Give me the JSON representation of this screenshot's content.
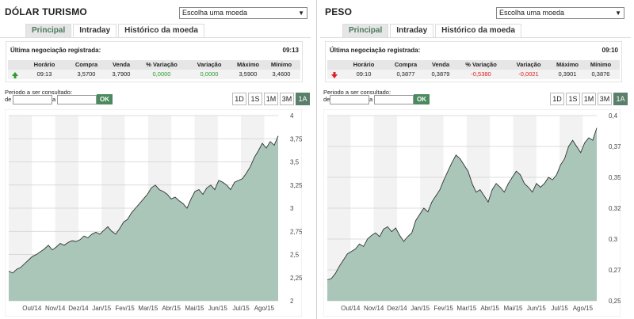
{
  "panels": [
    {
      "id": "dolar",
      "title": "DÓLAR TURISMO",
      "select_label": "Escolha uma moeda",
      "tabs": [
        "Principal",
        "Intraday",
        "Histórico da moeda"
      ],
      "active_tab": 0,
      "quote": {
        "header": "Última negociação registrada:",
        "time": "09:13",
        "direction": "up",
        "columns": [
          "Horário",
          "Compra",
          "Venda",
          "% Variação",
          "Variação",
          "Máximo",
          "Mínimo"
        ],
        "values": [
          "09:13",
          "3,5700",
          "3,7900",
          "0,0000",
          "0,0000",
          "3,5900",
          "3,4600"
        ],
        "value_colors": [
          "#222222",
          "#222222",
          "#222222",
          "#2e9e2e",
          "#2e9e2e",
          "#222222",
          "#222222"
        ]
      },
      "period": {
        "label": "Periodo a ser consultado:",
        "from_label": "de",
        "to_label": "a",
        "ok": "OK"
      },
      "ranges": [
        "1D",
        "1S",
        "1M",
        "3M",
        "1A"
      ],
      "active_range": 4,
      "chart_data": {
        "type": "area",
        "ylim": [
          2,
          4
        ],
        "yticks": [
          "2",
          "2,25",
          "2,5",
          "2,75",
          "3",
          "3,25",
          "3,5",
          "3,75",
          "4"
        ],
        "ytick_values": [
          2,
          2.25,
          2.5,
          2.75,
          3,
          3.25,
          3.5,
          3.75,
          4
        ],
        "xlabels": [
          "Out/14",
          "Nov/14",
          "Dez/14",
          "Jan/15",
          "Fev/15",
          "Mar/15",
          "Abr/15",
          "Mai/15",
          "Jun/15",
          "Jul/15",
          "Ago/15"
        ],
        "values": [
          2.32,
          2.3,
          2.34,
          2.36,
          2.4,
          2.44,
          2.48,
          2.5,
          2.53,
          2.56,
          2.6,
          2.55,
          2.58,
          2.62,
          2.6,
          2.63,
          2.65,
          2.64,
          2.66,
          2.7,
          2.68,
          2.72,
          2.74,
          2.72,
          2.76,
          2.8,
          2.75,
          2.72,
          2.78,
          2.85,
          2.88,
          2.95,
          3.0,
          3.05,
          3.1,
          3.15,
          3.22,
          3.25,
          3.2,
          3.18,
          3.15,
          3.1,
          3.12,
          3.08,
          3.05,
          3.0,
          3.1,
          3.18,
          3.2,
          3.15,
          3.22,
          3.25,
          3.2,
          3.3,
          3.28,
          3.25,
          3.2,
          3.28,
          3.3,
          3.32,
          3.38,
          3.45,
          3.55,
          3.62,
          3.7,
          3.65,
          3.72,
          3.68,
          3.78
        ]
      }
    },
    {
      "id": "peso",
      "title": "PESO",
      "select_label": "Escolha uma moeda",
      "tabs": [
        "Principal",
        "Intraday",
        "Histórico da moeda"
      ],
      "active_tab": 0,
      "quote": {
        "header": "Última negociação registrada:",
        "time": "09:10",
        "direction": "down",
        "columns": [
          "Horário",
          "Compra",
          "Venda",
          "% Variação",
          "Variação",
          "Máximo",
          "Mínimo"
        ],
        "values": [
          "09:10",
          "0,3877",
          "0,3879",
          "-0,5380",
          "-0,0021",
          "0,3901",
          "0,3876"
        ],
        "value_colors": [
          "#222222",
          "#222222",
          "#222222",
          "#e02020",
          "#e02020",
          "#222222",
          "#222222"
        ]
      },
      "period": {
        "label": "Periodo a ser consultado:",
        "from_label": "de",
        "to_label": "a",
        "ok": "OK"
      },
      "ranges": [
        "1D",
        "1S",
        "1M",
        "3M",
        "1A"
      ],
      "active_range": 4,
      "chart_data": {
        "type": "area",
        "ylim": [
          0.25,
          0.4
        ],
        "yticks": [
          "0,25",
          "0,275",
          "0,3",
          "0,325",
          "0,35",
          "0,375",
          "0,4"
        ],
        "ytick_values": [
          0.25,
          0.275,
          0.3,
          0.325,
          0.35,
          0.375,
          0.4
        ],
        "xlabels": [
          "Out/14",
          "Nov/14",
          "Dez/14",
          "Jan/15",
          "Fev/15",
          "Mar/15",
          "Abr/15",
          "Mai/15",
          "Jun/15",
          "Jul/15",
          "Ago/15"
        ],
        "values": [
          0.267,
          0.268,
          0.272,
          0.278,
          0.283,
          0.288,
          0.29,
          0.292,
          0.296,
          0.294,
          0.3,
          0.303,
          0.305,
          0.302,
          0.308,
          0.31,
          0.306,
          0.309,
          0.303,
          0.298,
          0.302,
          0.305,
          0.315,
          0.32,
          0.325,
          0.322,
          0.33,
          0.335,
          0.34,
          0.348,
          0.355,
          0.362,
          0.368,
          0.365,
          0.36,
          0.355,
          0.345,
          0.338,
          0.34,
          0.335,
          0.33,
          0.34,
          0.345,
          0.342,
          0.338,
          0.345,
          0.35,
          0.355,
          0.352,
          0.345,
          0.342,
          0.338,
          0.345,
          0.342,
          0.345,
          0.35,
          0.348,
          0.352,
          0.36,
          0.365,
          0.375,
          0.38,
          0.375,
          0.37,
          0.378,
          0.382,
          0.38,
          0.39
        ]
      }
    }
  ]
}
